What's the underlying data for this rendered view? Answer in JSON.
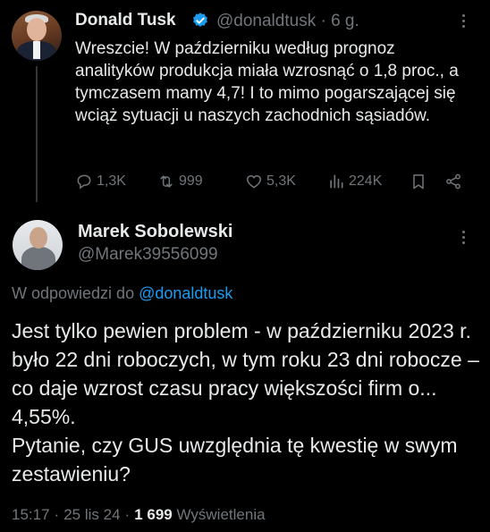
{
  "colors": {
    "background": "#000000",
    "text": "#e7e9ea",
    "muted": "#71767b",
    "accent": "#1d9bf0"
  },
  "tweet1": {
    "author_name": "Donald Tusk",
    "verified": true,
    "handle": "@donaldtusk",
    "time": "· 6 g.",
    "text": "Wreszcie! W październiku według prognoz analityków produkcja miała wzrosnąć o 1,8 proc., a tymczasem mamy 4,7! I to mimo pogarszającej się wciąż sytuacji u naszych zachodnich sąsiadów.",
    "actions": {
      "replies": "1,3K",
      "retweets": "999",
      "likes": "5,3K",
      "views": "224K"
    },
    "icons": [
      "reply-icon",
      "retweet-icon",
      "like-icon",
      "views-icon",
      "bookmark-icon",
      "share-icon",
      "more-icon",
      "verified-icon"
    ]
  },
  "tweet2": {
    "author_name": "Marek Sobolewski",
    "handle": "@Marek39556099",
    "replying_prefix": "W odpowiedzi do",
    "replying_to": "@donaldtusk",
    "text": "Jest tylko pewien problem - w październiku 2023 r. było 22 dni roboczych, w tym roku 23 dni robocze – co daje wzrost czasu pracy większości firm o... 4,55%.\nPytanie, czy GUS uwzględnia tę kwestię w swym zestawieniu?",
    "time": "15:17",
    "date": "25 lis 24",
    "views_count": "1 699",
    "views_label": "Wyświetlenia"
  }
}
